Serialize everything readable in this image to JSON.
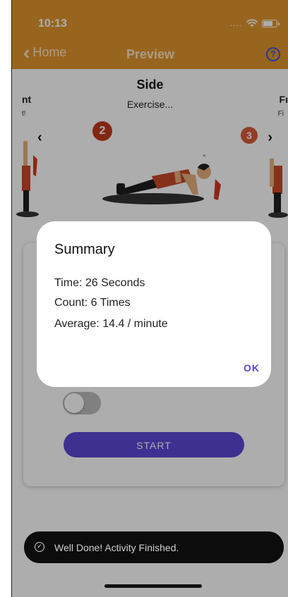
{
  "status_bar": {
    "time": "10:13",
    "signal_text": "....",
    "wifi_icon": "wifi-icon",
    "battery_icon": "battery-icon"
  },
  "nav": {
    "back_label": "Home",
    "title": "Preview",
    "help_icon": "help-icon",
    "help_glyph": "?"
  },
  "exercise": {
    "title": "Side",
    "subtitle": "Exercise...",
    "left_title": "nt",
    "left_sub": "t!",
    "right_title": "Fı",
    "right_sub": "Fi",
    "badge_current": "2",
    "badge_next": "3",
    "prev_glyph": "‹",
    "next_glyph": "›"
  },
  "card": {
    "start_label": "START"
  },
  "dialog": {
    "title": "Summary",
    "time_line": "Time: 26 Seconds",
    "count_line": "Count: 6 Times",
    "average_line": "Average: 14.4 / minute",
    "ok_label": "OK"
  },
  "toast": {
    "message": "Well Done! Activity Finished.",
    "icon_glyph": "✓"
  },
  "colors": {
    "header": "#e0952f",
    "accent": "#5a48d6",
    "badge": "#c23a1e",
    "toast_bg": "#0c0c0c"
  }
}
